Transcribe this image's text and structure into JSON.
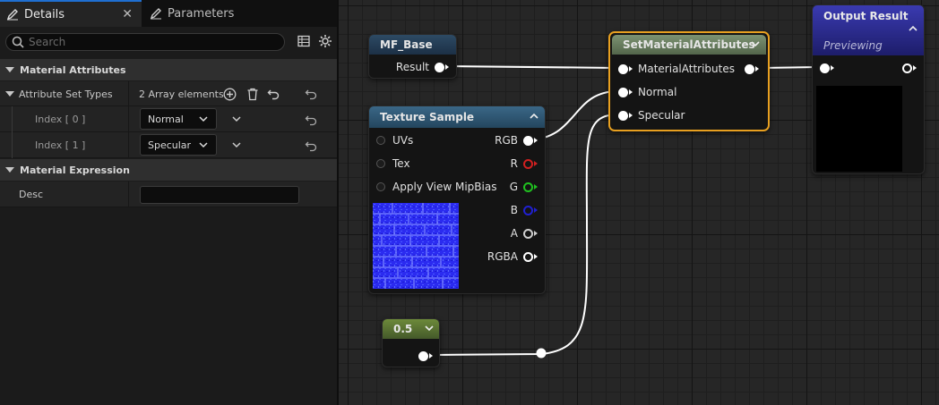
{
  "tabs": {
    "details": "Details",
    "parameters": "Parameters"
  },
  "search": {
    "placeholder": "Search"
  },
  "material_attributes": {
    "title": "Material Attributes",
    "attribute_set_types_label": "Attribute Set Types",
    "array_elements": "2 Array elements",
    "index0_label": "Index [ 0 ]",
    "index0_value": "Normal",
    "index1_label": "Index [ 1 ]",
    "index1_value": "Specular"
  },
  "material_expression": {
    "title": "Material Expression",
    "desc_label": "Desc",
    "desc_value": ""
  },
  "nodes": {
    "mf_base": {
      "title": "MF_Base",
      "output": "Result"
    },
    "texture_sample": {
      "title": "Texture Sample",
      "inputs": [
        "UVs",
        "Tex",
        "Apply View MipBias"
      ],
      "outputs": [
        "RGB",
        "R",
        "G",
        "B",
        "A",
        "RGBA"
      ]
    },
    "set_attrs": {
      "title": "SetMaterialAttributes",
      "inputs": [
        "MaterialAttributes",
        "Normal",
        "Specular"
      ]
    },
    "output_result": {
      "title": "Output Result",
      "subtitle": "Previewing"
    },
    "constant": {
      "value": "0.5"
    }
  },
  "colors": {
    "accent": "#1f6fd1",
    "selected_outline": "#e8a020",
    "r_pin": "#d02020",
    "g_pin": "#20c020",
    "b_pin": "#2020d0"
  }
}
